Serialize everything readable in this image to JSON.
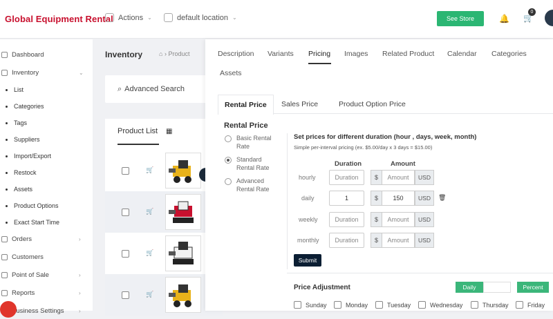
{
  "app": {
    "brand": "Global Equipment Rental",
    "actions_label": "Actions",
    "location_label": "default location",
    "see_store_label": "See Store",
    "cart_count": "0"
  },
  "sidebar": {
    "items": [
      {
        "label": "Dashboard"
      },
      {
        "label": "Inventory"
      }
    ],
    "sub_items": [
      {
        "label": "List"
      },
      {
        "label": "Categories"
      },
      {
        "label": "Tags"
      },
      {
        "label": "Suppliers"
      },
      {
        "label": "Import/Export"
      },
      {
        "label": "Restock"
      },
      {
        "label": "Assets"
      },
      {
        "label": "Product Options"
      },
      {
        "label": "Exact Start Time"
      }
    ],
    "bottom_items": [
      {
        "label": "Orders"
      },
      {
        "label": "Customers"
      },
      {
        "label": "Point of Sale"
      },
      {
        "label": "Reports"
      },
      {
        "label": "Business Settings"
      }
    ]
  },
  "main": {
    "title": "Inventory",
    "breadcrumb": "Product",
    "advanced_search": "Advanced Search",
    "product_list_title": "Product List"
  },
  "panel": {
    "tabs": [
      "Description",
      "Variants",
      "Pricing",
      "Images",
      "Related Product",
      "Calendar",
      "Categories",
      "Assets"
    ],
    "subtabs": [
      "Rental Price",
      "Sales Price",
      "Product Option Price"
    ],
    "rental_price_title": "Rental Price",
    "radio_options": [
      {
        "line1": "Basic Rental",
        "line2": "Rate",
        "checked": false
      },
      {
        "line1": "Standard",
        "line2": "Rental Rate",
        "checked": true
      },
      {
        "line1": "Advanced",
        "line2": "Rental Rate",
        "checked": false
      }
    ],
    "set_prices_title": "Set prices for different duration (hour , days, week, month)",
    "set_prices_sub": "Simple per-interval pricing (ex. $5.00/day x 3 days = $15.00)",
    "col_duration": "Duration",
    "col_amount": "Amount",
    "rows": [
      {
        "label": "hourly",
        "duration": "",
        "duration_placeholder": "Duration",
        "amount": "",
        "amount_placeholder": "Amount",
        "currency": "USD",
        "currency_symbol": "$"
      },
      {
        "label": "daily",
        "duration": "1",
        "duration_placeholder": "Duration",
        "amount": "150",
        "amount_placeholder": "Amount",
        "currency": "USD",
        "currency_symbol": "$"
      },
      {
        "label": "weekly",
        "duration": "",
        "duration_placeholder": "Duration",
        "amount": "",
        "amount_placeholder": "Amount",
        "currency": "USD",
        "currency_symbol": "$"
      },
      {
        "label": "monthly",
        "duration": "",
        "duration_placeholder": "Duration",
        "amount": "",
        "amount_placeholder": "Amount",
        "currency": "USD",
        "currency_symbol": "$"
      }
    ],
    "submit_label": "Submit",
    "price_adjustment_title": "Price Adjustment",
    "daily_pill": "Daily",
    "percent_pill": "Percent",
    "days": [
      "Sunday",
      "Monday",
      "Tuesday",
      "Wednesday",
      "Thursday",
      "Friday"
    ]
  }
}
